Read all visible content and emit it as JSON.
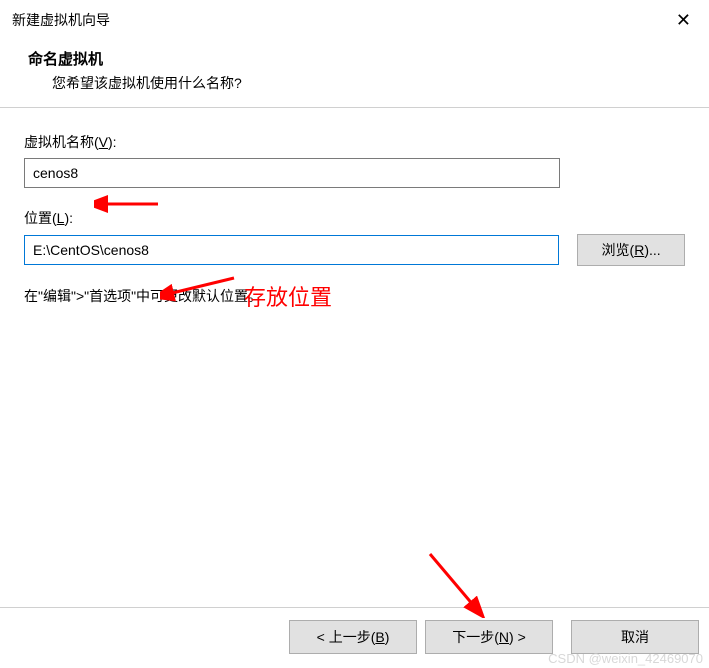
{
  "window": {
    "title": "新建虚拟机向导",
    "close_symbol": "✕"
  },
  "header": {
    "title": "命名虚拟机",
    "subtitle": "您希望该虚拟机使用什么名称?"
  },
  "fields": {
    "name": {
      "label_prefix": "虚拟机名称(",
      "hotkey": "V",
      "label_suffix": "):",
      "value": "cenos8"
    },
    "location": {
      "label_prefix": "位置(",
      "hotkey": "L",
      "label_suffix": "):",
      "value": "E:\\CentOS\\cenos8",
      "browse_prefix": "浏览(",
      "browse_hotkey": "R",
      "browse_suffix": ")..."
    }
  },
  "hint": "在\"编辑\">\"首选项\"中可更改默认位置。",
  "footer": {
    "back_prefix": "< 上一步(",
    "back_hotkey": "B",
    "back_suffix": ")",
    "next_prefix": "下一步(",
    "next_hotkey": "N",
    "next_suffix": ") >",
    "cancel": "取消"
  },
  "annotations": {
    "location_label": "存放位置"
  },
  "watermark": "CSDN @weixin_42469070"
}
